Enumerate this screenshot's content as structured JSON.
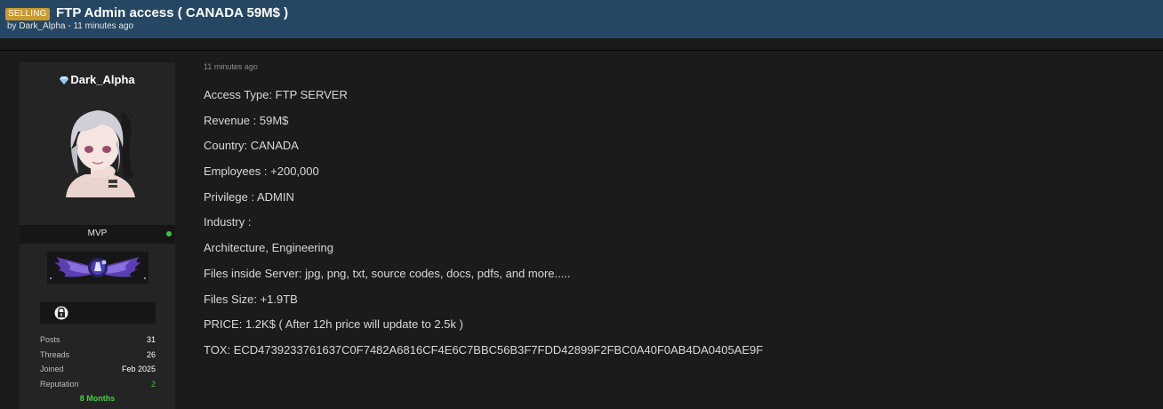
{
  "thread": {
    "prefix": "SELLING",
    "title": "FTP Admin access ( CANADA 59M$ )",
    "meta": "by Dark_Alpha - 11 minutes ago"
  },
  "user": {
    "name": "Dark_Alpha",
    "avatar_icon": "anime-avatar",
    "rank": "MVP",
    "online_status_color": "#3bc43b",
    "rank_emblem_icon": "winged-emblem",
    "award_icon": "lock-award-icon",
    "stats": [
      {
        "label": "Posts",
        "value": "31"
      },
      {
        "label": "Threads",
        "value": "26"
      },
      {
        "label": "Joined",
        "value": "Feb 2025"
      },
      {
        "label": "Reputation",
        "value": "2"
      }
    ],
    "tenure": "8 Months"
  },
  "post": {
    "time": "11 minutes ago",
    "lines": [
      "Access Type: FTP SERVER",
      "Revenue : 59M$",
      "Country: CANADA",
      "Employees : +200,000",
      "Privilege : ADMIN",
      "Industry :",
      "Architecture, Engineering",
      "Files inside Server: jpg, png, txt, source codes, docs, pdfs, and more.....",
      "Files Size: +1.9TB",
      "PRICE: 1.2K$ ( After 12h price will update to 2.5k )",
      "TOX: ECD4739233761637C0F7482A6816CF4E6C7BBC56B3F7FDD42899F2FBC0A40F0AB4DA0405AE9F"
    ]
  },
  "colors": {
    "header_bg": "#264763",
    "prefix_bg": "#c99a2e",
    "page_bg": "#1b1b1b",
    "panel_bg": "#242424",
    "accent_green": "#3bc43b"
  }
}
